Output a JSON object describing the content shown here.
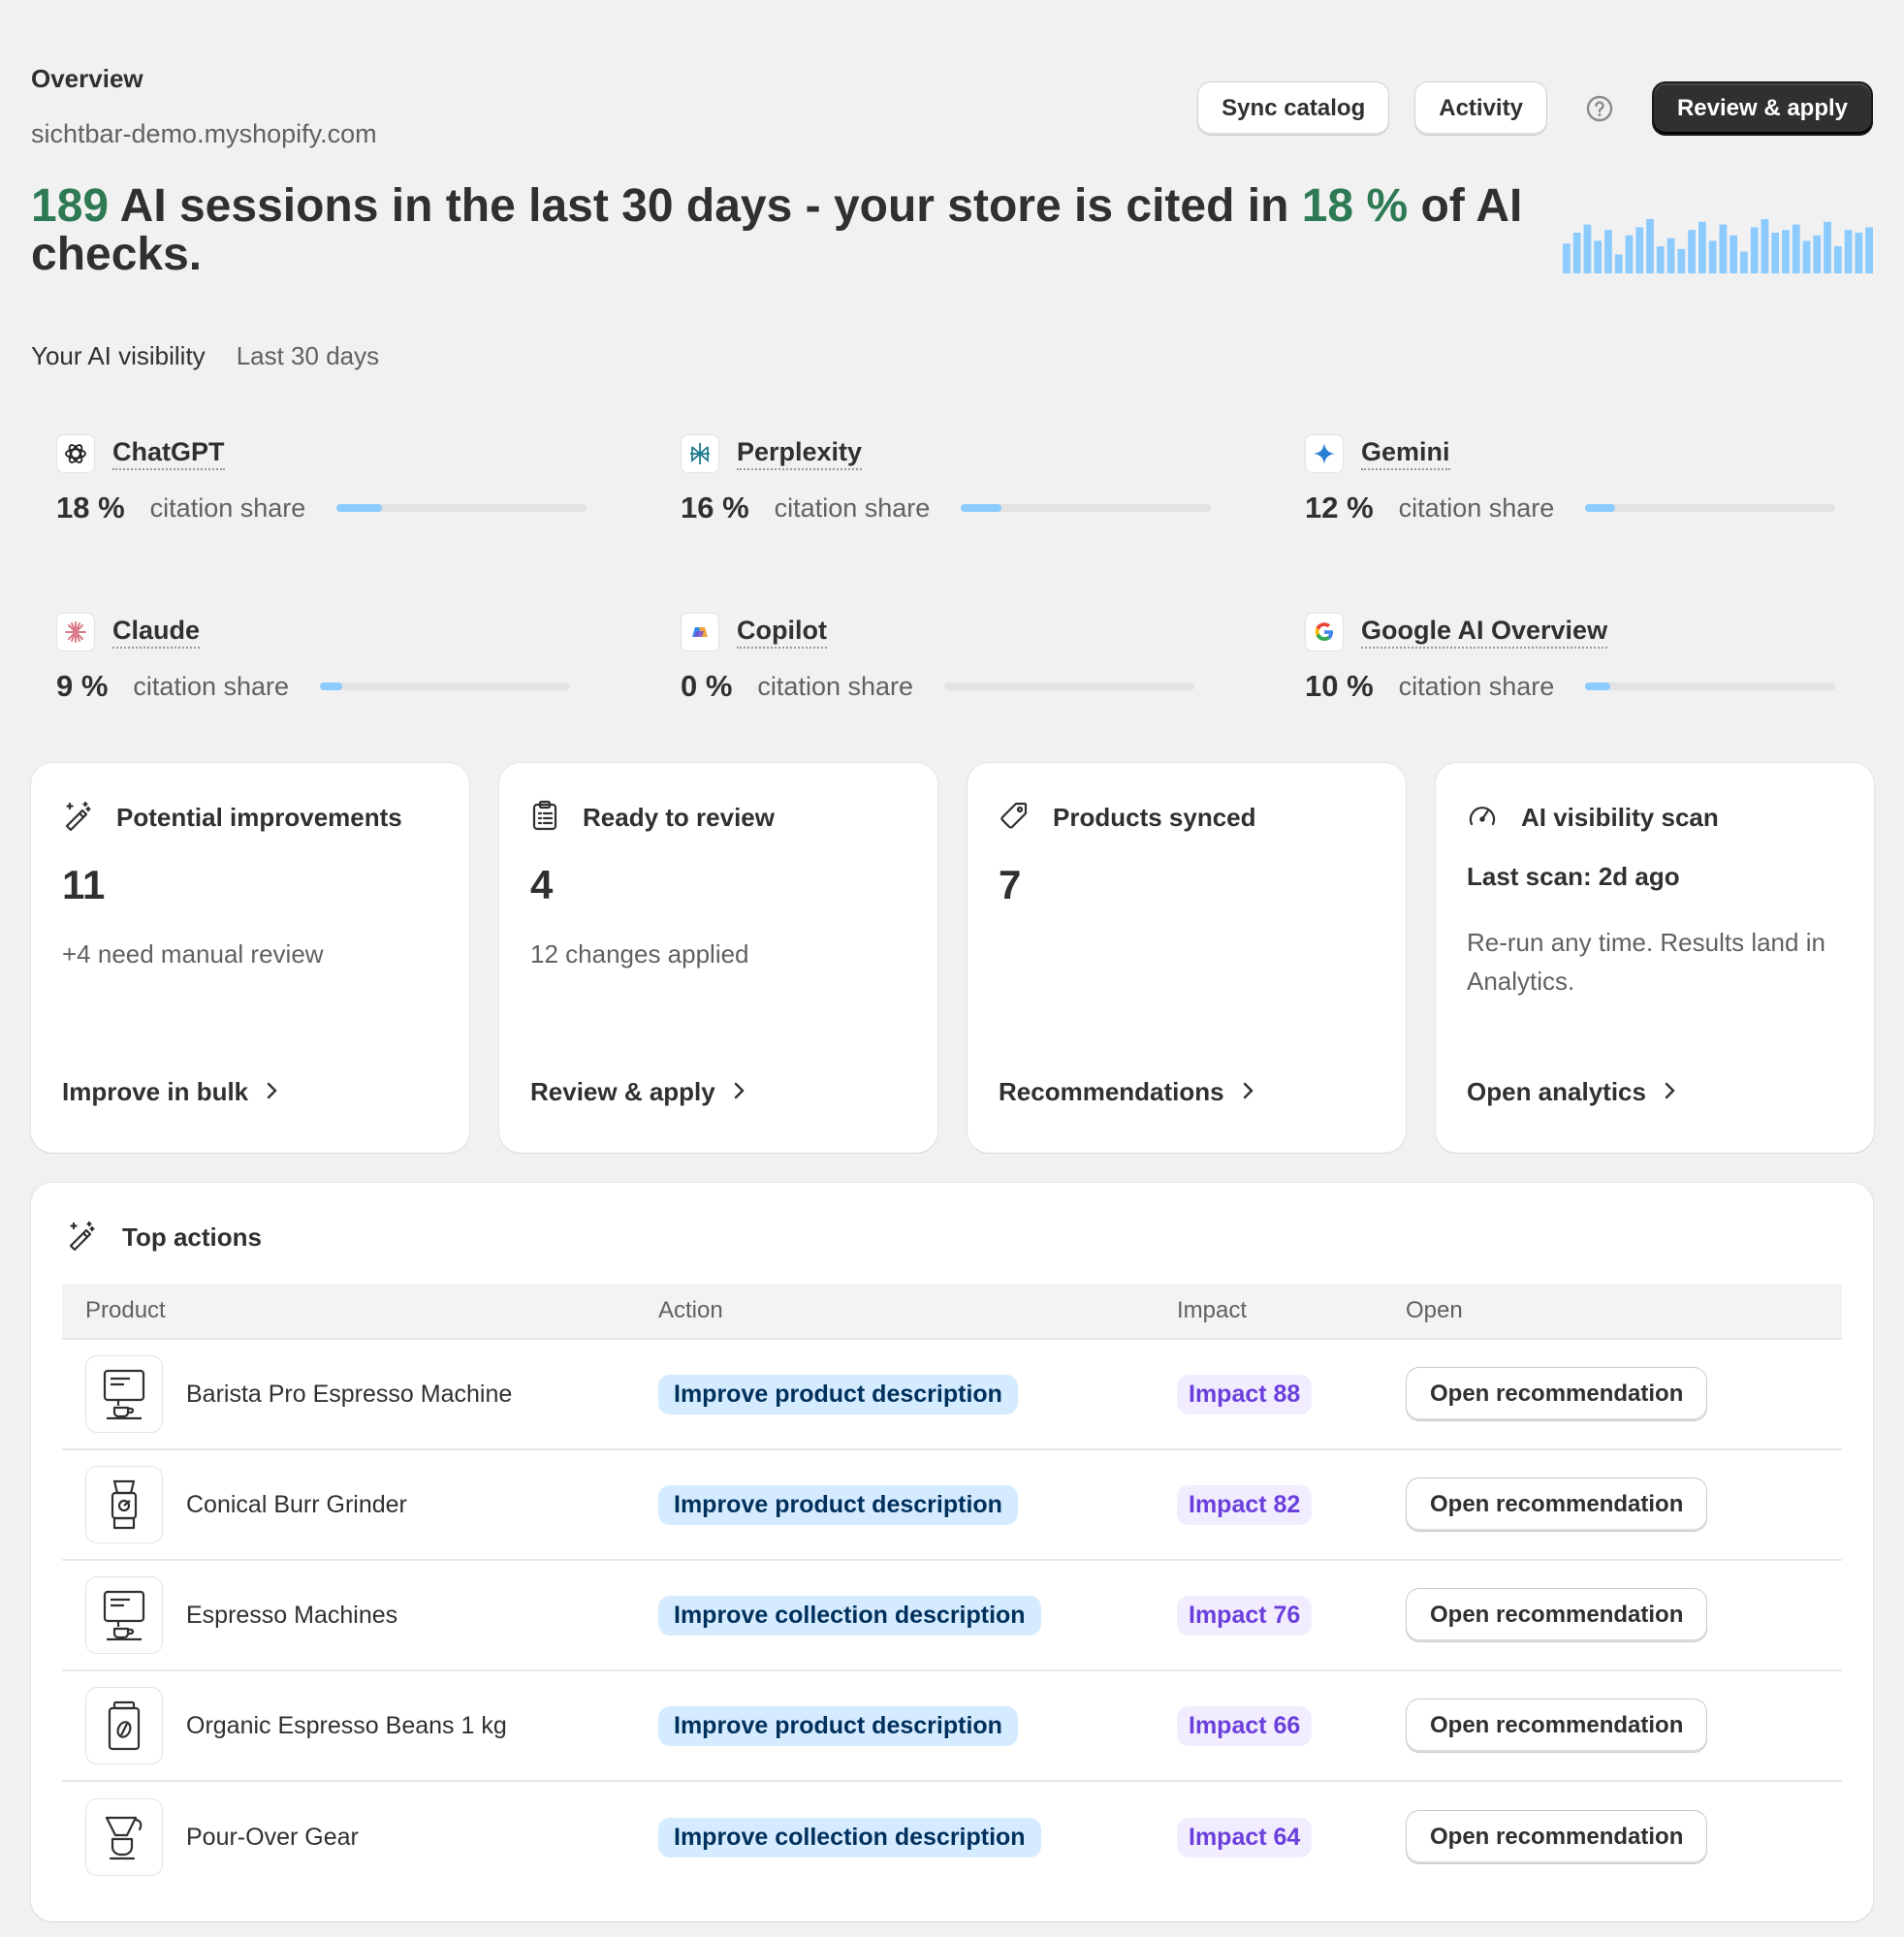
{
  "header": {
    "title": "Overview",
    "store_domain": "sichtbar-demo.myshopify.com",
    "sync_label": "Sync catalog",
    "activity_label": "Activity",
    "review_label": "Review & apply"
  },
  "hero": {
    "sessions": "189",
    "text_a": " AI sessions in the last 30 days - your store is cited in ",
    "percent": "18 %",
    "text_b": " of AI checks.",
    "sparkline": [
      0.55,
      0.75,
      0.9,
      0.6,
      0.8,
      0.35,
      0.7,
      0.85,
      1.0,
      0.5,
      0.65,
      0.45,
      0.8,
      0.95,
      0.6,
      0.9,
      0.7,
      0.4,
      0.85,
      1.0,
      0.75,
      0.8,
      0.9,
      0.6,
      0.7,
      0.95,
      0.5,
      0.8,
      0.75,
      0.85
    ],
    "accent_color": "#2d7a55",
    "bar_color": "#8ccbff"
  },
  "visibility": {
    "title": "Your AI visibility",
    "range": "Last 30 days",
    "stat_label": "citation share",
    "platforms": [
      {
        "name": "ChatGPT",
        "pct": "18 %",
        "value": 0.18,
        "icon": "chatgpt-icon"
      },
      {
        "name": "Perplexity",
        "pct": "16 %",
        "value": 0.16,
        "icon": "perplexity-icon"
      },
      {
        "name": "Gemini",
        "pct": "12 %",
        "value": 0.12,
        "icon": "gemini-icon"
      },
      {
        "name": "Claude",
        "pct": "9 %",
        "value": 0.09,
        "icon": "claude-icon"
      },
      {
        "name": "Copilot",
        "pct": "0 %",
        "value": 0.0,
        "icon": "copilot-icon"
      },
      {
        "name": "Google AI Overview",
        "pct": "10 %",
        "value": 0.1,
        "icon": "google-icon"
      }
    ]
  },
  "cards": {
    "improvements": {
      "title": "Potential improvements",
      "value": "11",
      "sub": "+4 need manual review",
      "link": "Improve in bulk"
    },
    "review": {
      "title": "Ready to review",
      "value": "4",
      "sub": "12 changes applied",
      "link": "Review & apply"
    },
    "synced": {
      "title": "Products synced",
      "value": "7",
      "link": "Recommendations"
    },
    "scan": {
      "title": "AI visibility scan",
      "last_scan": "Last scan: 2d ago",
      "desc": "Re-run any time. Results land in Analytics.",
      "link": "Open analytics"
    }
  },
  "top_actions": {
    "title": "Top actions",
    "columns": {
      "product": "Product",
      "action": "Action",
      "impact": "Impact",
      "open": "Open"
    },
    "open_label": "Open recommendation",
    "rows": [
      {
        "product": "Barista Pro Espresso Machine",
        "action": "Improve product description",
        "impact": "Impact 88",
        "icon": "espresso-machine-icon"
      },
      {
        "product": "Conical Burr Grinder",
        "action": "Improve product description",
        "impact": "Impact 82",
        "icon": "grinder-icon"
      },
      {
        "product": "Espresso Machines",
        "action": "Improve collection description",
        "impact": "Impact 76",
        "icon": "espresso-machine-icon"
      },
      {
        "product": "Organic Espresso Beans 1 kg",
        "action": "Improve product description",
        "impact": "Impact 66",
        "icon": "coffee-bag-icon"
      },
      {
        "product": "Pour-Over Gear",
        "action": "Improve collection description",
        "impact": "Impact 64",
        "icon": "pour-over-icon"
      }
    ]
  }
}
